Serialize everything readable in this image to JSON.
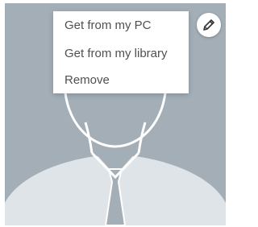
{
  "menu": {
    "items": [
      {
        "label": "Get from my PC"
      },
      {
        "label": "Get from my library"
      },
      {
        "label": "Remove"
      }
    ]
  },
  "icons": {
    "edit": "pencil-icon",
    "avatar": "default-person-silhouette"
  },
  "colors": {
    "avatar_background": "#a3aeb6",
    "silhouette_outline": "#ffffff",
    "shirt": "#dfe4e8",
    "menu_text": "#505050"
  }
}
